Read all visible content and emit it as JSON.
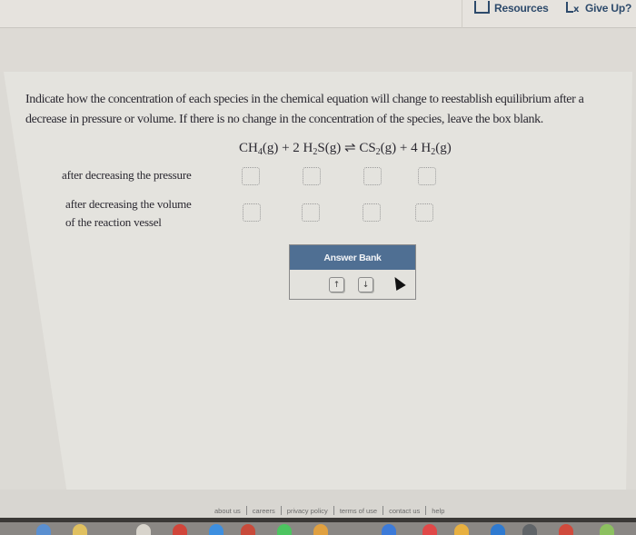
{
  "topbar": {
    "resources_label": "Resources",
    "giveup_label": "Give Up?"
  },
  "question": {
    "prompt": "Indicate how the concentration of each species in the chemical equation will change to reestablish equilibrium after a decrease in pressure or volume. If there is no change in the concentration of the species, leave the box blank.",
    "equation": {
      "reactant1": "CH",
      "reactant1_sub": "4",
      "reactant1_state": "(g) + 2 H",
      "reactant2_sub": "2",
      "reactant2_state": "S(g)",
      "arrow": "⇌",
      "product1": "CS",
      "product1_sub": "2",
      "product1_state": "(g) + 4 H",
      "product2_sub": "2",
      "product2_state": "(g)"
    },
    "species": [
      "CH4(g)",
      "H2S(g)",
      "CS2(g)",
      "H2(g)"
    ],
    "rows": [
      {
        "label_line1": "after decreasing the pressure",
        "label_line2": "",
        "answers": [
          "",
          "",
          "",
          ""
        ]
      },
      {
        "label_line1": "after decreasing the volume",
        "label_line2": "of the reaction vessel",
        "answers": [
          "",
          "",
          "",
          ""
        ]
      }
    ]
  },
  "answer_bank": {
    "title": "Answer Bank",
    "chips": [
      "↑",
      "↓"
    ]
  },
  "footer": {
    "links": [
      "about us",
      "careers",
      "privacy policy",
      "terms of use",
      "contact us",
      "help"
    ]
  }
}
